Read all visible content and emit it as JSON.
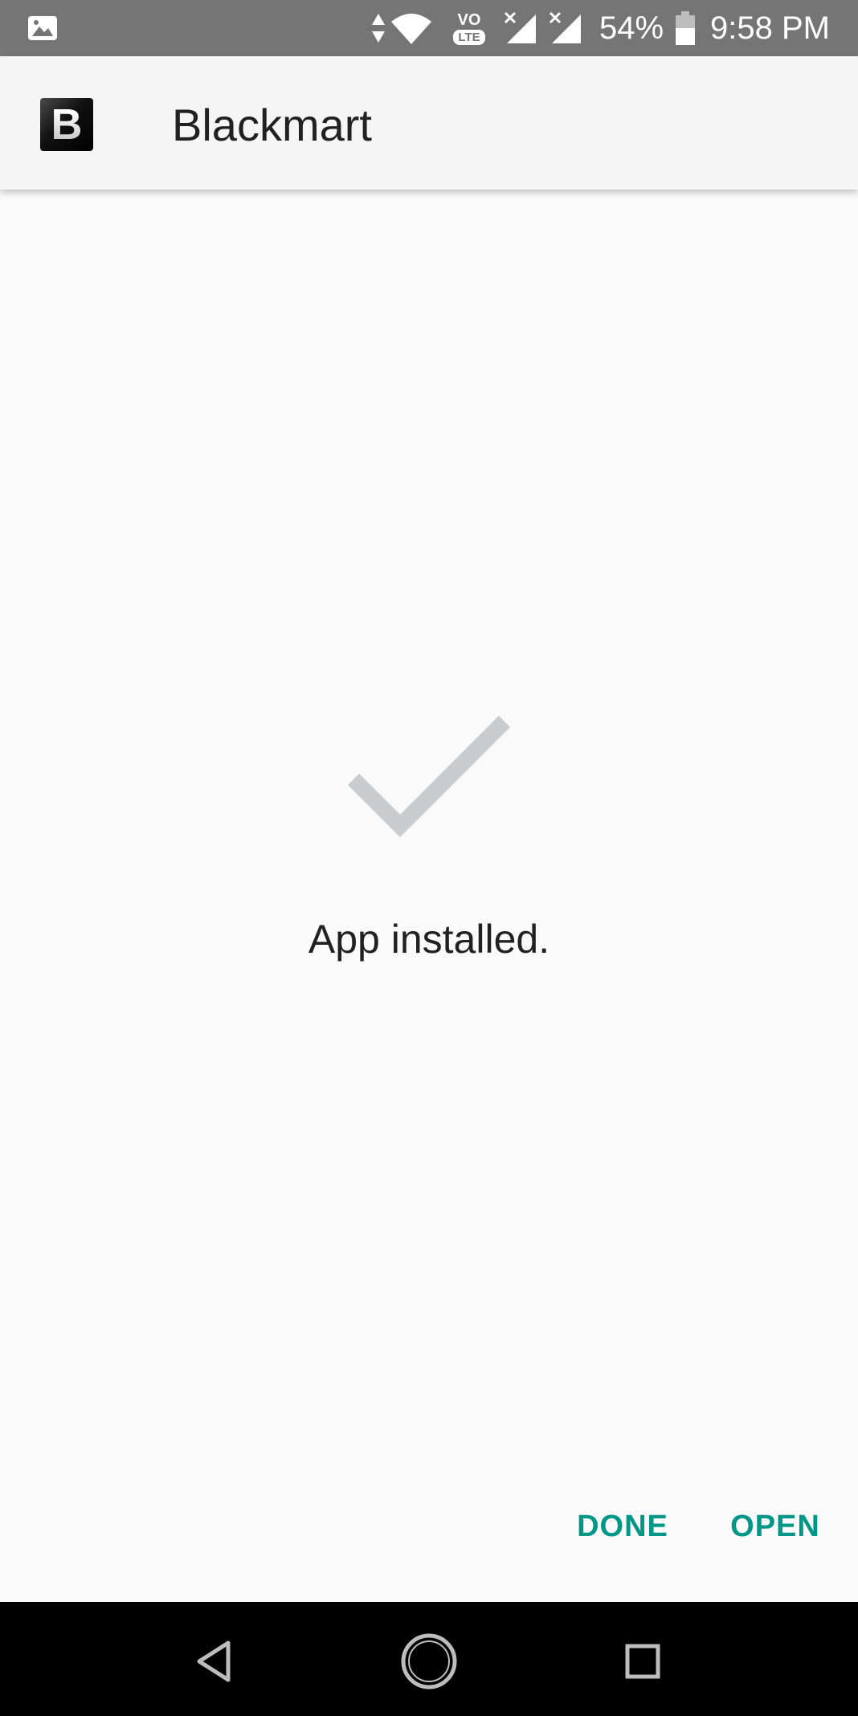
{
  "status_bar": {
    "battery_percent": "54%",
    "time": "9:58 PM",
    "network_badge_top": "VO",
    "network_badge_bottom": "LTE",
    "icons": [
      "image-notification-icon",
      "data-arrows-icon",
      "wifi-icon",
      "volte-icon",
      "signal-icon",
      "signal-icon",
      "battery-icon"
    ]
  },
  "app_bar": {
    "logo_letter": "B",
    "title": "Blackmart"
  },
  "main": {
    "message": "App installed.",
    "check_color": "#c9cdd0"
  },
  "actions": {
    "done_label": "DONE",
    "open_label": "OPEN",
    "accent_color": "#009688"
  },
  "nav_bar": {
    "icons": [
      "back-icon",
      "home-icon",
      "recents-icon"
    ]
  }
}
